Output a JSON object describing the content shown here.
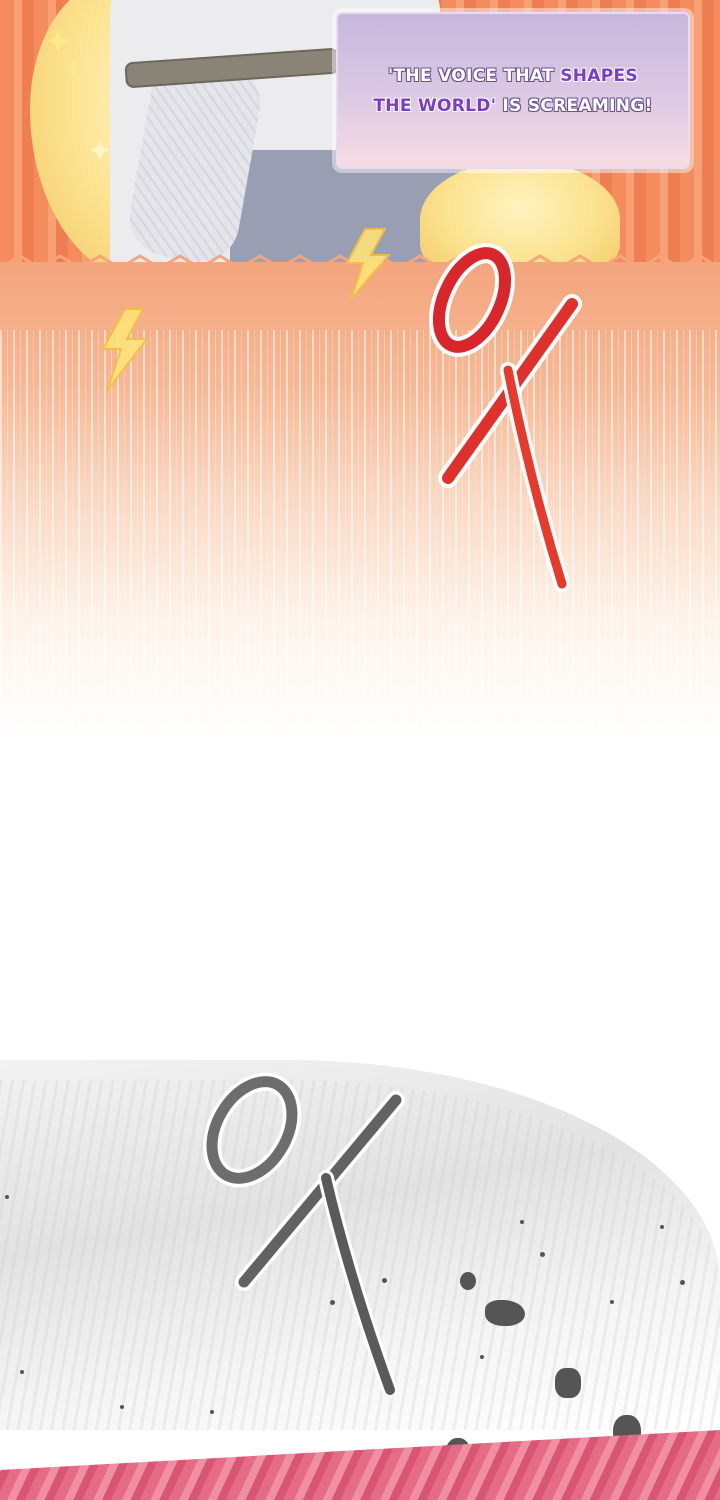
{
  "caption": {
    "line1": {
      "part1": "'THE VOICE THAT ",
      "highlight1": "SHAPES"
    },
    "line2": {
      "highlight1": "THE WORLD'",
      "part2": " IS SCREAMING!"
    }
  },
  "colors": {
    "background_top": "#f48c5e",
    "caption_box": "#c7b7dc",
    "caption_highlight": "#7a3dc4",
    "sfx_red": "#d8262b",
    "sfx_gray": "#6d6d6d",
    "bottom_panel": "#e56b86"
  }
}
